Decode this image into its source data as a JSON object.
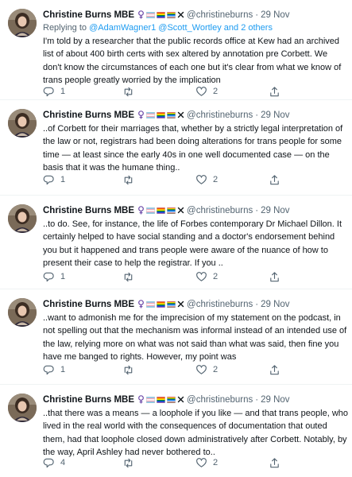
{
  "author": {
    "name": "Christine Burns MBE",
    "handle": "@christineburns",
    "flag_colors": {
      "trans": [
        "#5bcefa",
        "#f5a9b8",
        "#ffffff",
        "#f5a9b8",
        "#5bcefa"
      ],
      "rainbow": [
        "#e40303",
        "#ff8c00",
        "#ffed00",
        "#008026",
        "#004dff",
        "#750787"
      ],
      "progress": [
        "#e40303",
        "#ffed00",
        "#008026",
        "#004dff",
        "#5bcefa",
        "#f5a9b8",
        "#613915"
      ]
    },
    "badge_icon": "x-mark-icon"
  },
  "reply_context": {
    "prefix": "Replying to",
    "mentions": "@AdamWagner1 @Scott_Wortley",
    "and_others": "and 2 others"
  },
  "tweets": [
    {
      "time": "29 Nov",
      "text": "I'm told by a researcher that the public records office at Kew had an archived list of about 400 birth certs with sex altered by annotation pre Corbett. We don't know the circumstances of each one but it's clear from what we know of trans people greatly worried by the implication",
      "replies": "1",
      "retweets": "",
      "likes": "2"
    },
    {
      "time": "29 Nov",
      "text": "..of Corbett for their marriages that, whether by a strictly legal interpretation of the law or not, registrars had been doing alterations for trans people for some time — at least since the early 40s in one well documented case — on the basis that it was the humane thing..",
      "replies": "1",
      "retweets": "",
      "likes": "2"
    },
    {
      "time": "29 Nov",
      "text": "..to do. See, for instance, the life of Forbes contemporary Dr Michael Dillon. It certainly helped to have social standing and a doctor's endorsement behind you but it happened and trans people were aware of the nuance of how to present their case to help the registrar. If you ..",
      "replies": "1",
      "retweets": "",
      "likes": "2"
    },
    {
      "time": "29 Nov",
      "text": "..want to admonish me for the imprecision of my statement on the podcast, in not spelling out that the mechanism was informal instead of an intended use of the law, relying more on what was not said than what was said, then fine you have me banged to rights. However, my point was",
      "replies": "1",
      "retweets": "",
      "likes": "2"
    },
    {
      "time": "29 Nov",
      "text": "..that there was a means — a loophole if you like — and that trans people, who lived in the real world with the consequences of documentation that outed them,  had that loophole closed down administratively after Corbett. Notably, by the way, April Ashley had never bothered to..",
      "replies": "4",
      "retweets": "",
      "likes": "2"
    }
  ],
  "action_icons": [
    "reply-icon",
    "retweet-icon",
    "like-icon",
    "share-icon"
  ]
}
